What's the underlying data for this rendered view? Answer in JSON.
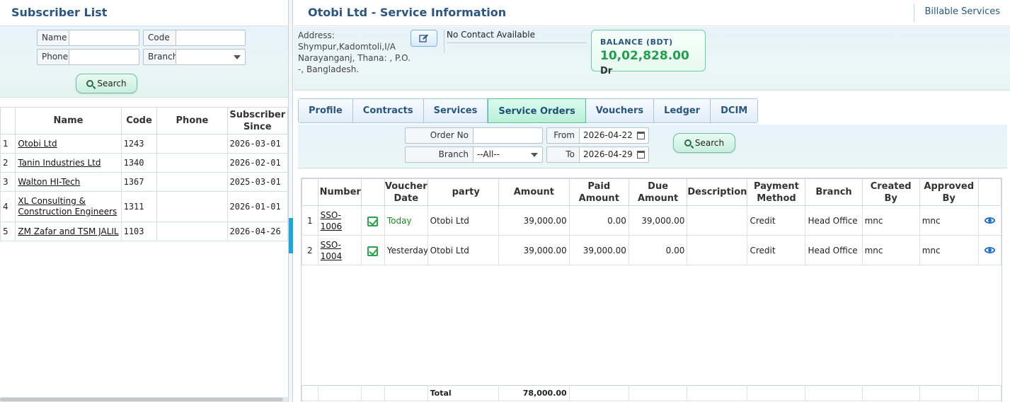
{
  "subscriber_list": {
    "title": "Subscriber List",
    "filters": {
      "name_label": "Name",
      "code_label": "Code",
      "phone_label": "Phone",
      "branch_label": "Branch",
      "search_label": "Search"
    },
    "columns": [
      "Name",
      "Code",
      "Phone",
      "Subscriber Since"
    ],
    "rows": [
      {
        "index": "1",
        "name": "Otobi Ltd",
        "code": "1243",
        "phone": "",
        "since": "2026-03-01"
      },
      {
        "index": "2",
        "name": "Tanin Industries Ltd",
        "code": "1340",
        "phone": "",
        "since": "2026-02-01"
      },
      {
        "index": "3",
        "name": "Walton HI-Tech",
        "code": "1367",
        "phone": "",
        "since": "2025-03-01"
      },
      {
        "index": "4",
        "name": "XL Consulting & Construction Engineers",
        "code": "1311",
        "phone": "",
        "since": "2026-01-01"
      },
      {
        "index": "5",
        "name": "ZM Zafar and TSM JALIL",
        "code": "1103",
        "phone": "",
        "since": "2026-04-26"
      }
    ]
  },
  "service_info": {
    "title": "Otobi Ltd - Service Information",
    "billable_link": "Billable Services",
    "address": "Address: Shympur,Kadomtoli,I/A Narayanganj, Thana: , P.O. -, Bangladesh.",
    "contact": "No Contact Available",
    "balance_label": "BALANCE (BDT)",
    "balance_value": "10,02,828.00",
    "balance_suffix": "Dr",
    "tabs": [
      "Profile",
      "Contracts",
      "Services",
      "Service Orders",
      "Vouchers",
      "Ledger",
      "DCIM"
    ],
    "active_tab": "Service Orders",
    "order_filter": {
      "order_no_label": "Order No",
      "branch_label": "Branch",
      "branch_value": "--All--",
      "from_label": "From",
      "from_value": "2026-04-22",
      "to_label": "To",
      "to_value": "2026-04-29",
      "search_label": "Search"
    },
    "columns": [
      "Number",
      "",
      "Voucher Date",
      "party",
      "Amount",
      "Paid Amount",
      "Due Amount",
      "Description",
      "Payment Method",
      "Branch",
      "Created By",
      "Approved By",
      ""
    ],
    "rows": [
      {
        "index": "1",
        "number": "SSO-1006",
        "date": "Today",
        "party": "Otobi Ltd",
        "amount": "39,000.00",
        "paid": "0.00",
        "due": "39,000.00",
        "description": "",
        "method": "Credit",
        "branch": "Head Office",
        "created_by": "mnc",
        "approved_by": "mnc"
      },
      {
        "index": "2",
        "number": "SSO-1004",
        "date": "Yesterday",
        "party": "Otobi Ltd",
        "amount": "39,000.00",
        "paid": "39,000.00",
        "due": "0.00",
        "description": "",
        "method": "Credit",
        "branch": "Head Office",
        "created_by": "mnc",
        "approved_by": "mnc"
      }
    ],
    "total_label": "Total",
    "total_amount": "78,000.00"
  }
}
